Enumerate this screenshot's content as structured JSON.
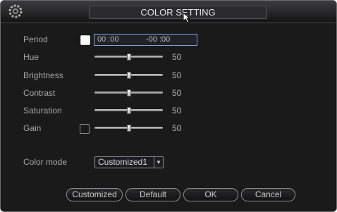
{
  "window": {
    "title": "COLOR SETTING",
    "icon": "gear-icon"
  },
  "period": {
    "label": "Period",
    "enabled": true,
    "start": "00 :00",
    "end": "-00 :00"
  },
  "sliders": [
    {
      "label": "Hue",
      "value": "50",
      "level": 50
    },
    {
      "label": "Brightness",
      "value": "50",
      "level": 50
    },
    {
      "label": "Contrast",
      "value": "50",
      "level": 50
    },
    {
      "label": "Saturation",
      "value": "50",
      "level": 50
    },
    {
      "label": "Gain",
      "value": "50",
      "level": 50
    }
  ],
  "gain": {
    "enabled": false
  },
  "color_mode": {
    "label": "Color mode",
    "selected": "Customized1"
  },
  "buttons": {
    "customized": "Customized",
    "default": "Default",
    "ok": "OK",
    "cancel": "Cancel"
  }
}
